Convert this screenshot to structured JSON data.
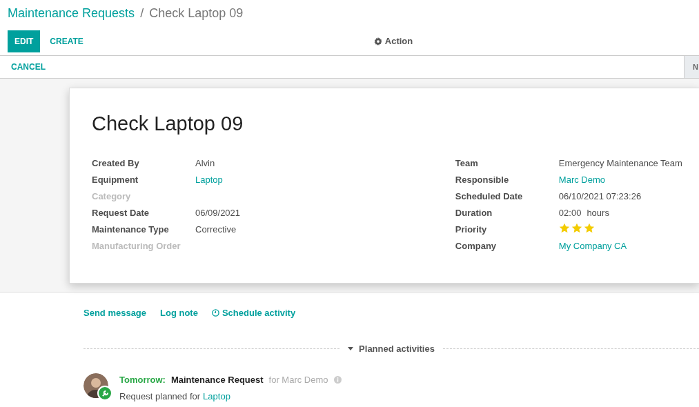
{
  "breadcrumb": [
    {
      "label": "Maintenance Requests",
      "kind": "link"
    },
    {
      "label": "/",
      "kind": "separator"
    },
    {
      "label": "Check Laptop 09",
      "kind": "current"
    }
  ],
  "buttons": [
    {
      "label": "EDIT",
      "kind": "primary"
    },
    {
      "label": "CREATE",
      "kind": "link"
    }
  ],
  "action": {
    "label": "Action"
  },
  "status_bar": {
    "buttons": [
      "CANCEL"
    ],
    "stage_cut": "N"
  },
  "sheet": {
    "title": "Check Laptop 09",
    "left_fields": [
      {
        "label": "Created By",
        "kind": "text",
        "value": "Alvin"
      },
      {
        "label": "Equipment",
        "kind": "link",
        "value": "Laptop"
      },
      {
        "label": "Category",
        "kind": "empty"
      },
      {
        "label": "Request Date",
        "kind": "text",
        "value": "06/09/2021"
      },
      {
        "label": "Maintenance Type",
        "kind": "text",
        "value": "Corrective"
      },
      {
        "label": "Manufacturing Order",
        "kind": "empty"
      }
    ],
    "right_fields": [
      {
        "label": "Team",
        "kind": "text",
        "value": "Emergency Maintenance Team"
      },
      {
        "label": "Responsible",
        "kind": "link",
        "value": "Marc Demo"
      },
      {
        "label": "Scheduled Date",
        "kind": "text",
        "value": "06/10/2021 07:23:26"
      },
      {
        "label": "Duration",
        "kind": "text",
        "value": "02:00",
        "unit": "hours"
      },
      {
        "label": "Priority",
        "kind": "stars",
        "stars": 3
      },
      {
        "label": "Company",
        "kind": "link",
        "value": "My Company CA"
      }
    ]
  },
  "chatter": {
    "buttons": [
      {
        "label": "Send message",
        "icon": false
      },
      {
        "label": "Log note",
        "icon": false
      },
      {
        "label": "Schedule activity",
        "icon": true
      }
    ],
    "section": "Planned activities",
    "activity": {
      "when": "Tomorrow:",
      "title": "Maintenance Request",
      "for": "for Marc Demo",
      "note": "Request planned for",
      "link": "Laptop"
    }
  }
}
